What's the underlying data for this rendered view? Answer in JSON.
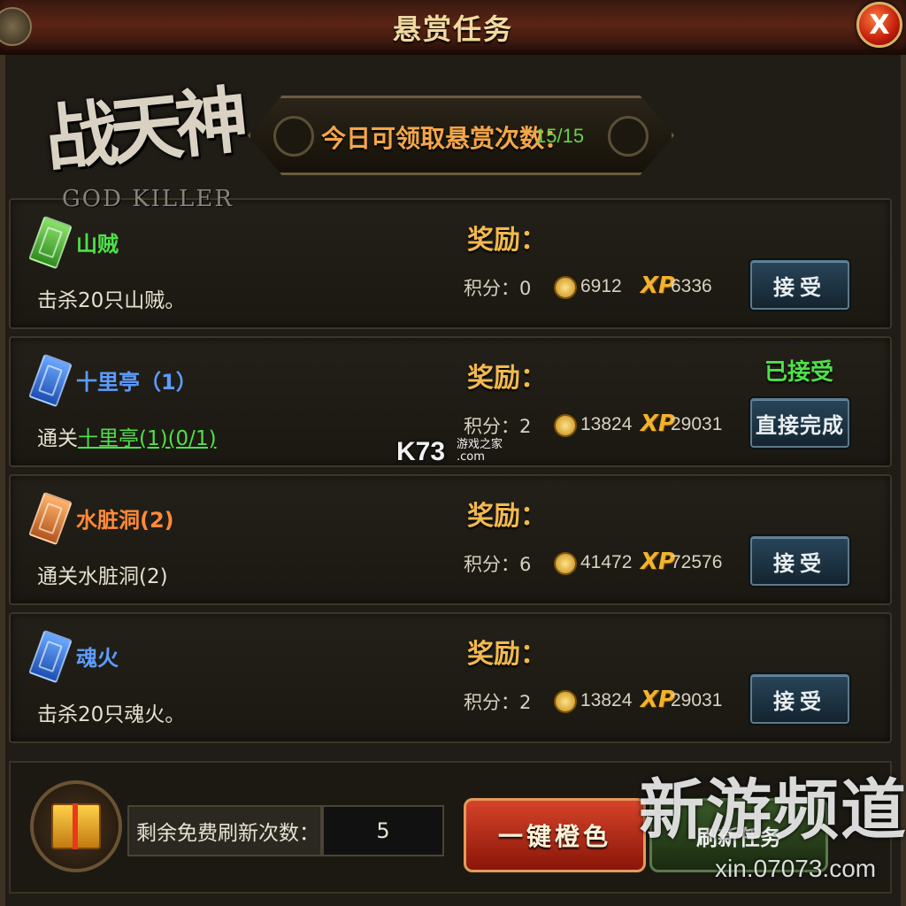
{
  "window": {
    "title": "悬赏任务",
    "close_label": "X"
  },
  "logo": {
    "cn": "战天神",
    "en": "GOD KILLER"
  },
  "counter": {
    "label": "今日可领取悬赏次数：",
    "value": "15/15"
  },
  "tasks": [
    {
      "color": "green",
      "name": "山贼",
      "desc_prefix": "击杀20只山贼。",
      "desc_link": "",
      "reward_label": "奖励：",
      "score": "积分：0",
      "gold": "6912",
      "xp": "6336",
      "status": "",
      "button": "接受"
    },
    {
      "color": "blue",
      "name": "十里亭（1）",
      "desc_prefix": "通关",
      "desc_link": "十里亭(1)(0/1)",
      "reward_label": "奖励：",
      "score": "积分：2",
      "gold": "13824",
      "xp": "29031",
      "status": "已接受",
      "button": "直接完成"
    },
    {
      "color": "orange",
      "name": "水脏洞(2)",
      "desc_prefix": "通关水脏洞(2)",
      "desc_link": "",
      "reward_label": "奖励：",
      "score": "积分：6",
      "gold": "41472",
      "xp": "72576",
      "status": "",
      "button": "接受"
    },
    {
      "color": "blue",
      "name": "魂火",
      "desc_prefix": "击杀20只魂火。",
      "desc_link": "",
      "reward_label": "奖励：",
      "score": "积分：2",
      "gold": "13824",
      "xp": "29031",
      "status": "",
      "button": "接受"
    }
  ],
  "xp_icon": "XP",
  "bottom": {
    "refresh_label": "剩余免费刷新次数：",
    "refresh_value": "5",
    "orange_button": "一键橙色",
    "second_button": "刷新任务"
  },
  "watermarks": {
    "k73": "K73",
    "k73_sub": "游戏之家",
    "k73_sub2": ".com",
    "xin": "新游频道",
    "xin_url": "xin.07073.com"
  }
}
